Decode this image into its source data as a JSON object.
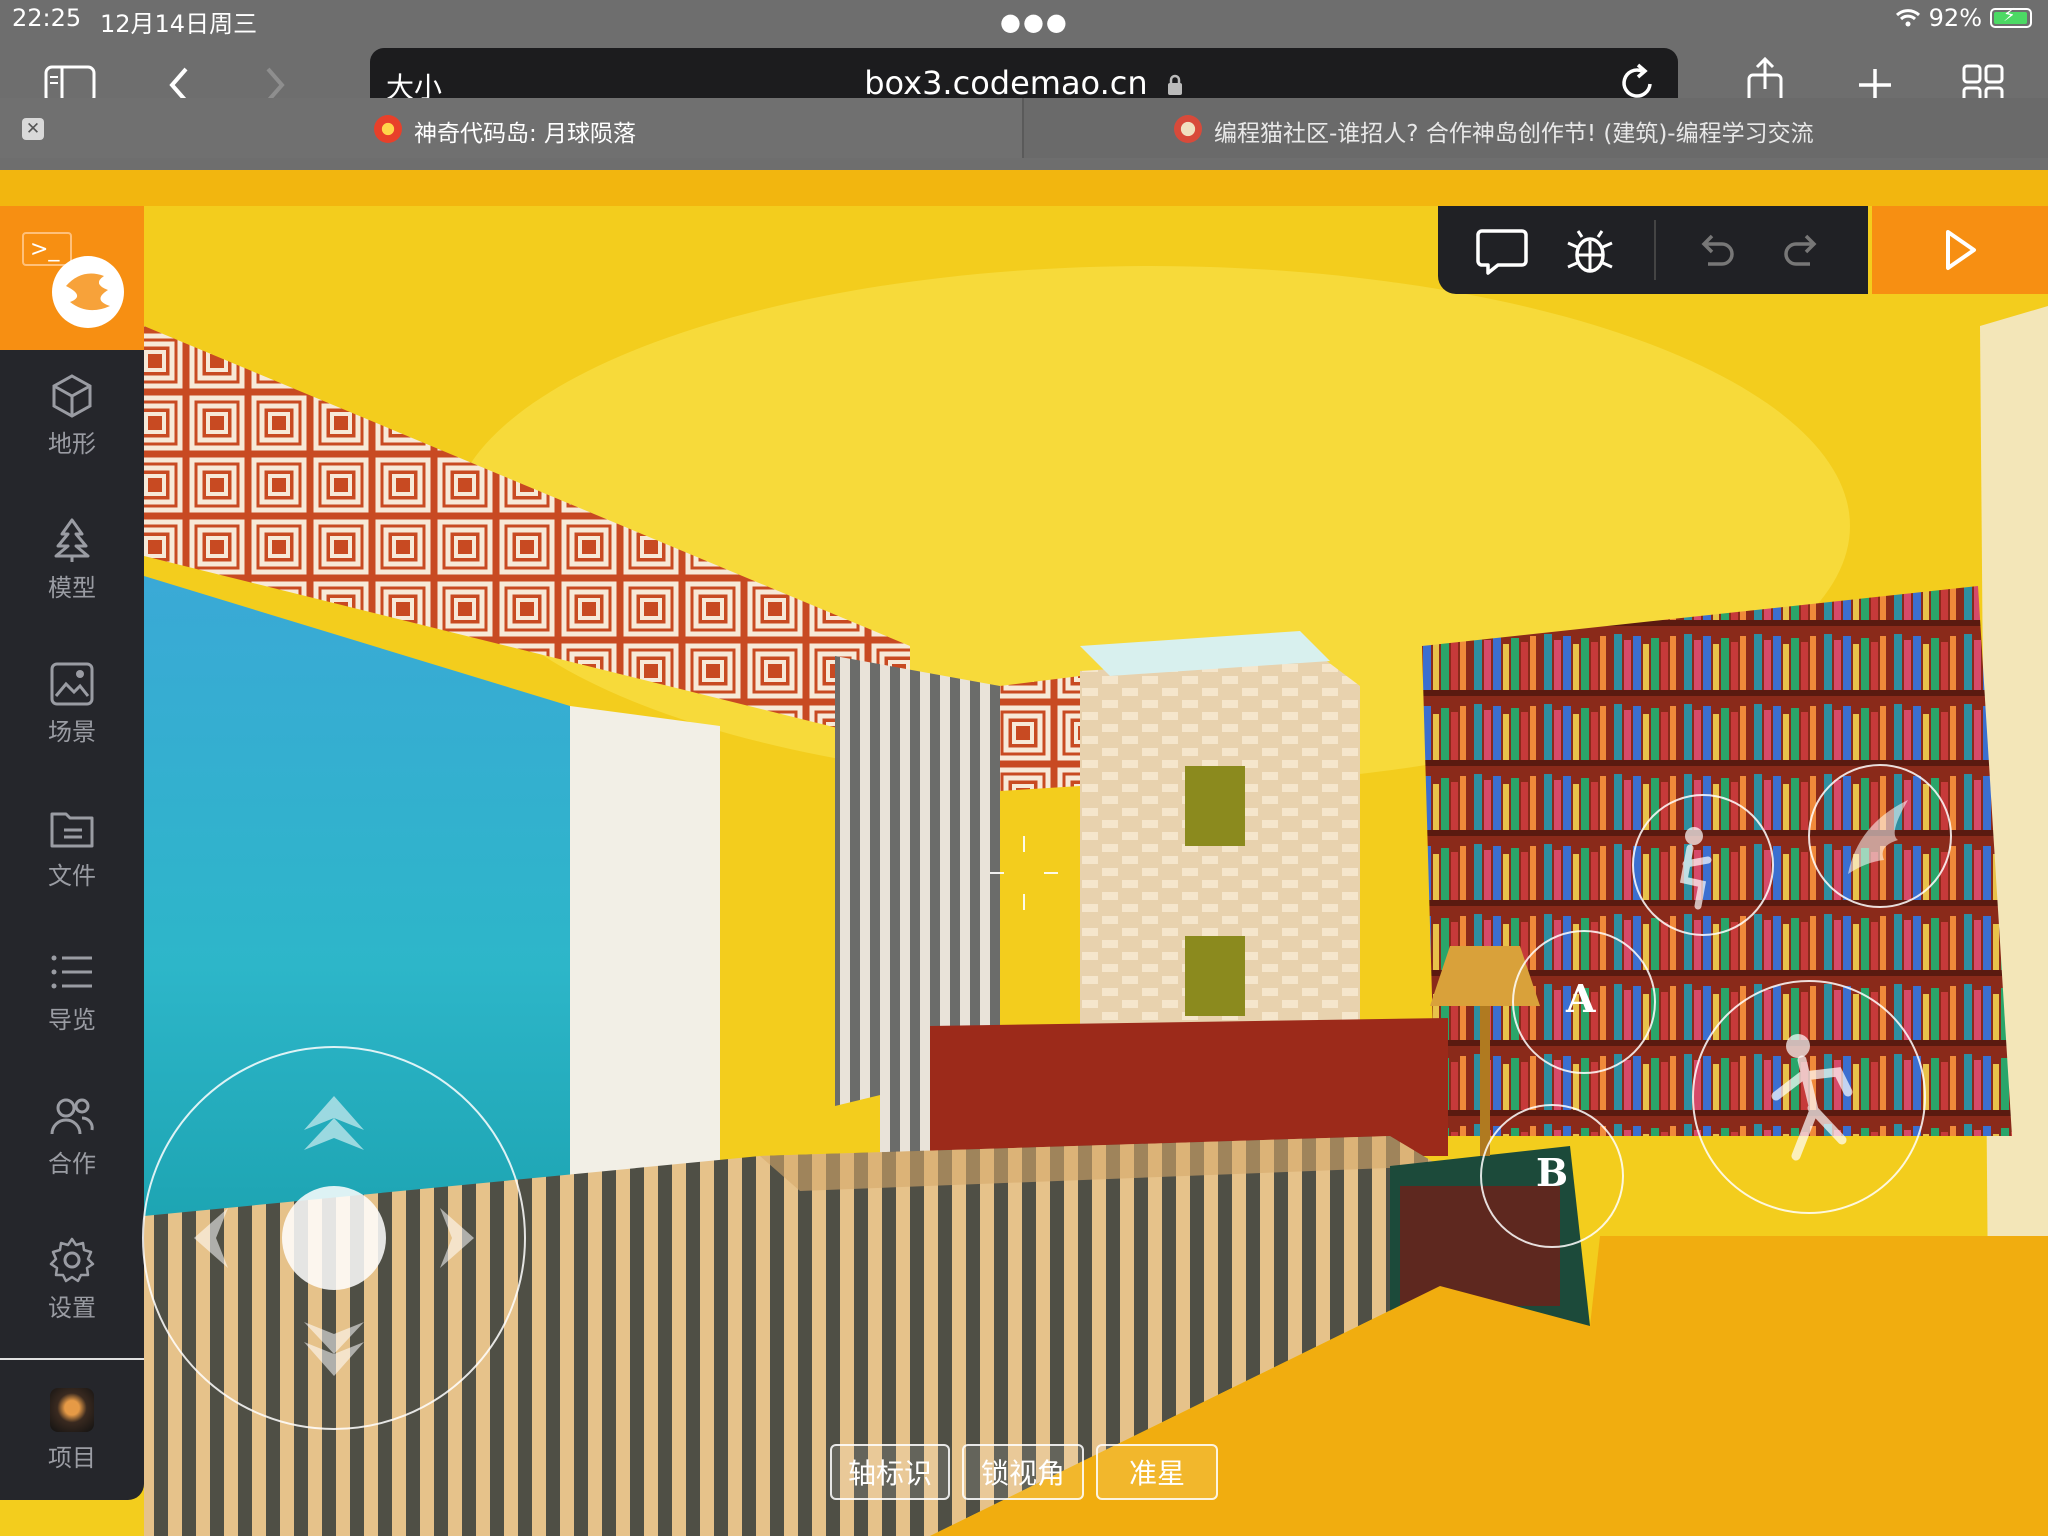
{
  "status_bar": {
    "time": "22:25",
    "date": "12月14日周三",
    "battery": "92%"
  },
  "browser": {
    "text_size_label": "大小",
    "url": "box3.codemao.cn",
    "tabs": [
      {
        "title": "神奇代码岛: 月球陨落",
        "active": true
      },
      {
        "title": "编程猫社区-谁招人? 合作神岛创作节! (建筑)-编程学习交流",
        "active": false
      }
    ]
  },
  "sidebar": {
    "items": [
      {
        "label": "地形",
        "icon": "cube-icon"
      },
      {
        "label": "模型",
        "icon": "tree-icon"
      },
      {
        "label": "场景",
        "icon": "image-icon"
      },
      {
        "label": "文件",
        "icon": "folder-icon"
      },
      {
        "label": "导览",
        "icon": "list-icon"
      },
      {
        "label": "合作",
        "icon": "users-icon"
      },
      {
        "label": "设置",
        "icon": "gear-icon"
      }
    ],
    "project_label": "项目"
  },
  "viewport_controls": {
    "axis_label": "轴标识",
    "lock_view_label": "锁视角",
    "crosshair_label": "准星"
  },
  "action_buttons": {
    "a_label": "A",
    "b_label": "B"
  },
  "colors": {
    "accent": "#f78f12",
    "sidebar_bg": "#25262b",
    "browser_chrome": "#6e6e6e"
  }
}
